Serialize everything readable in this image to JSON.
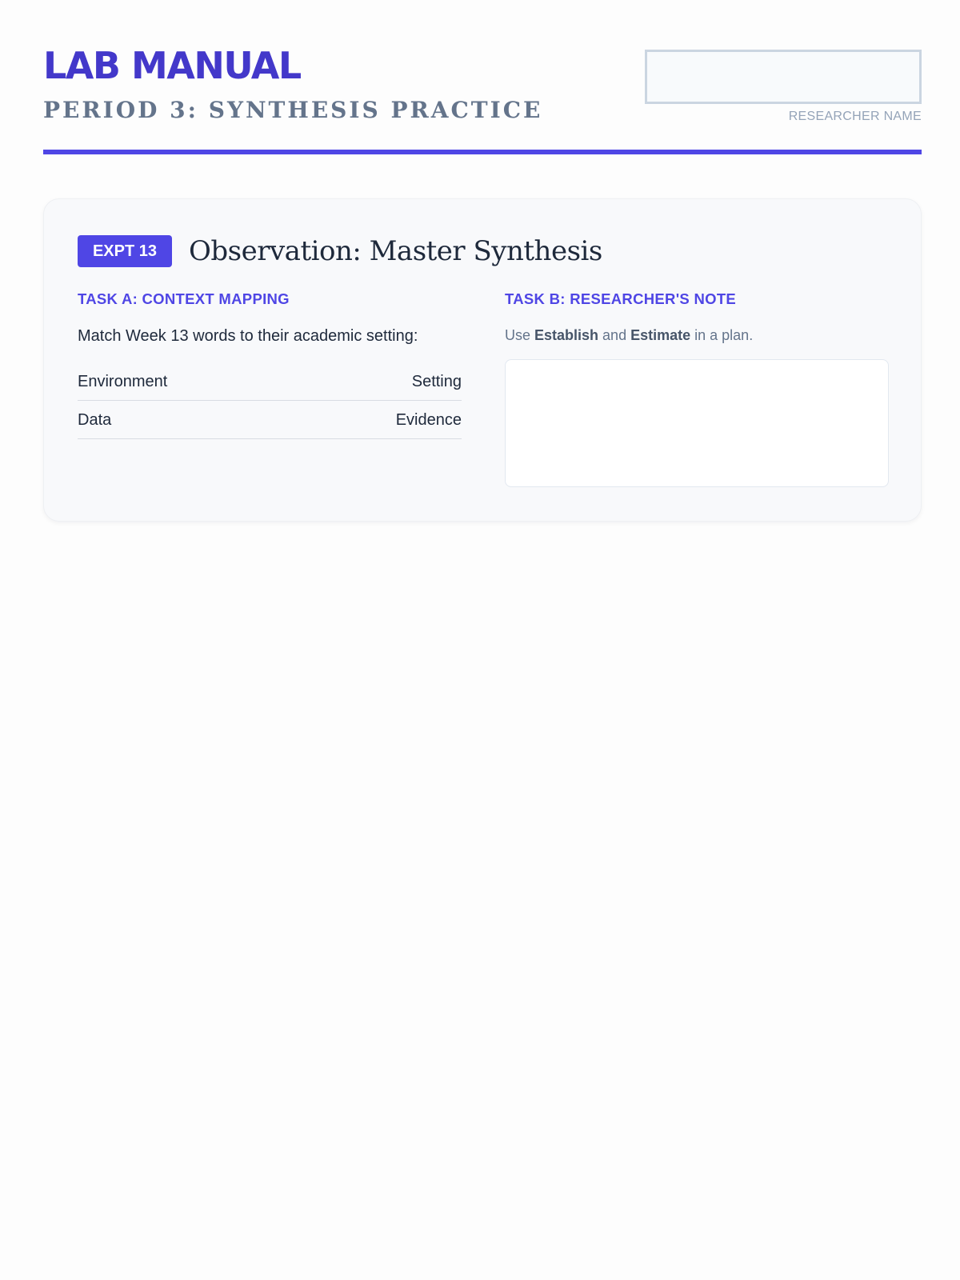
{
  "header": {
    "title": "LAB MANUAL",
    "subtitle": "PERIOD 3: SYNTHESIS PRACTICE",
    "name_field": {
      "label": "RESEARCHER NAME",
      "value": ""
    }
  },
  "experiment": {
    "badge": "EXPT 13",
    "title": "Observation: Master Synthesis",
    "task_a": {
      "heading": "TASK A: CONTEXT MAPPING",
      "prompt": "Match Week 13 words to their academic setting:",
      "rows": [
        {
          "word": "Environment",
          "setting": "Setting"
        },
        {
          "word": "Data",
          "setting": "Evidence"
        }
      ]
    },
    "task_b": {
      "heading": "TASK B: RESEARCHER'S NOTE",
      "instruction": {
        "prefix": "Use ",
        "term1": "Establish",
        "middle": " and ",
        "term2": "Estimate",
        "suffix": " in a plan."
      },
      "note_value": ""
    }
  },
  "colors": {
    "accent": "#4f46e5",
    "title": "#4338ca",
    "muted": "#64748b",
    "card_background": "#f8f9fb"
  }
}
